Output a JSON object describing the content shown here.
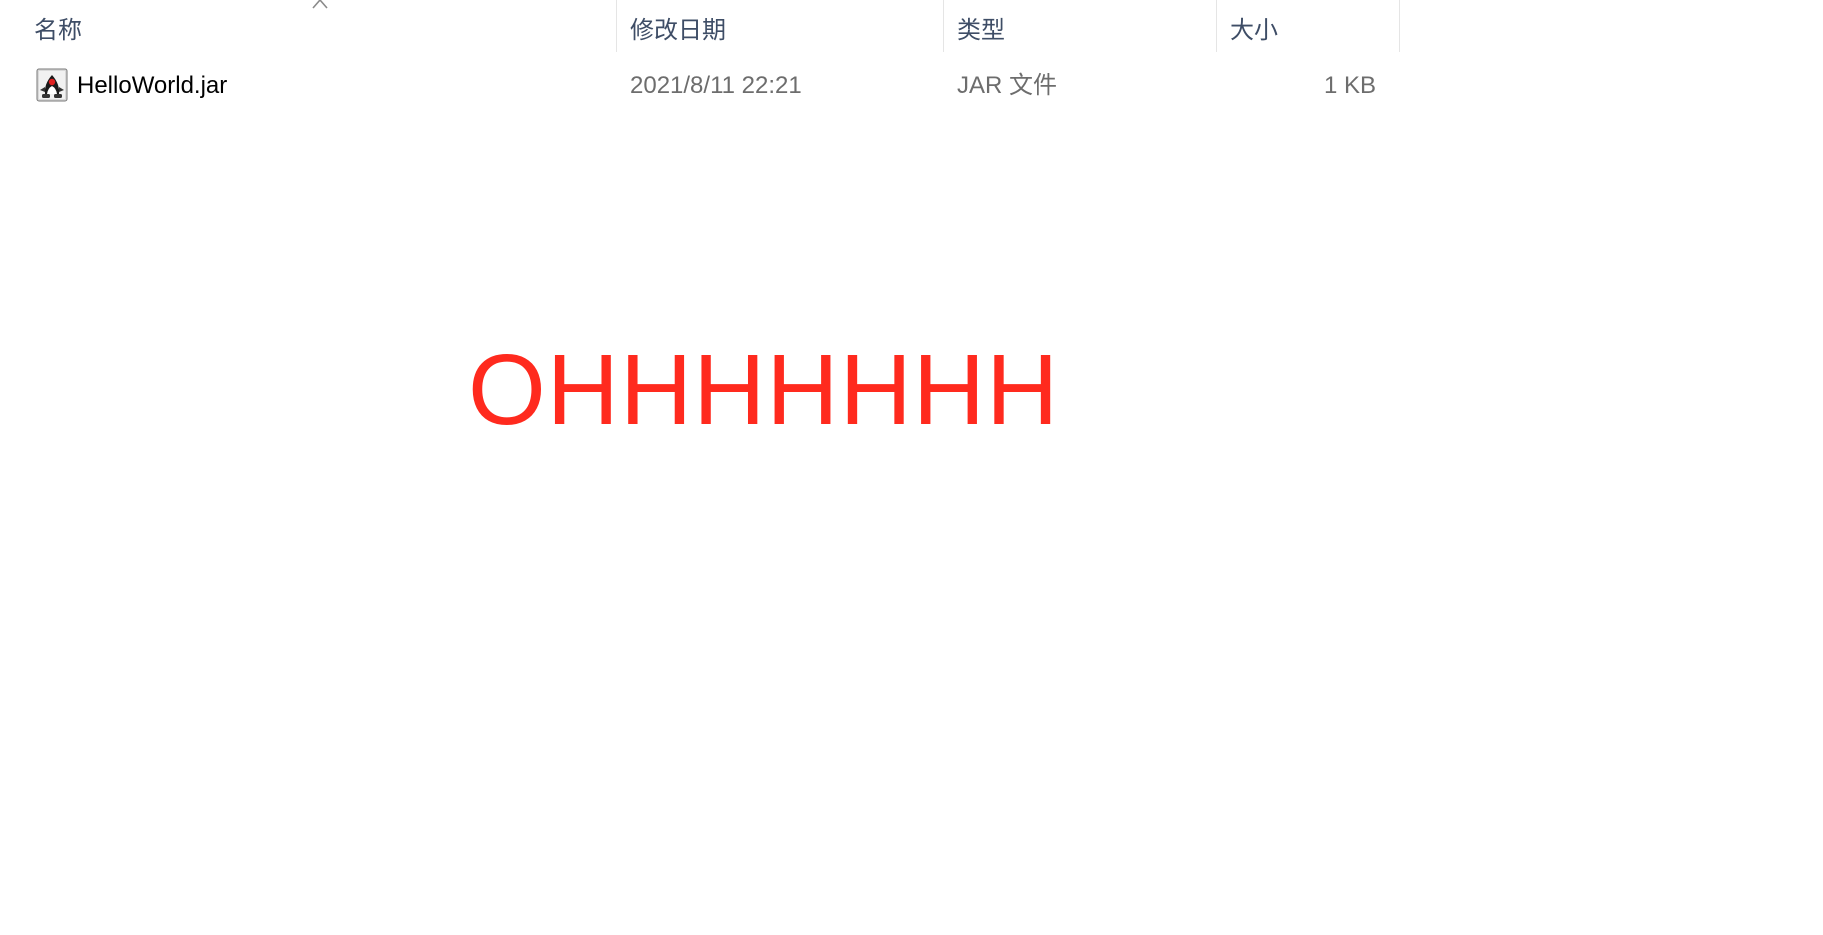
{
  "columns": {
    "name": "名称",
    "modified": "修改日期",
    "type": "类型",
    "size": "大小"
  },
  "sort_indicator_icon": "chevron-up-icon",
  "files": [
    {
      "icon": "java-jar-file-icon",
      "name": "HelloWorld.jar",
      "modified": "2021/8/11 22:21",
      "type": "JAR 文件",
      "size": "1 KB"
    }
  ],
  "overlay": {
    "text": "OHHHHHHH",
    "color": "#ff2a1e"
  },
  "colors": {
    "header_text": "#3e4d66",
    "muted_text": "#6d6d6d",
    "separator": "#e5e5e5"
  }
}
